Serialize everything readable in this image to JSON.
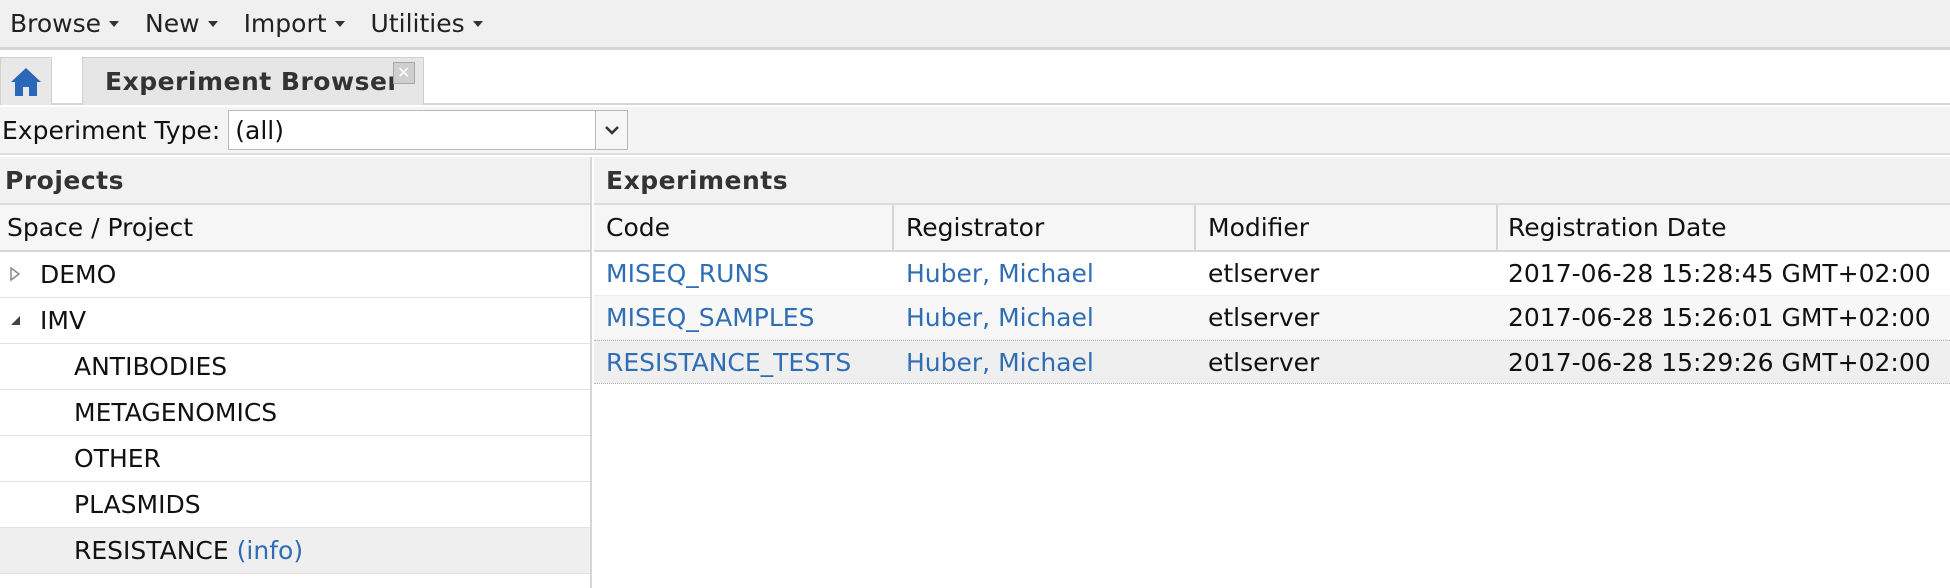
{
  "menu": {
    "items": [
      {
        "label": "Browse"
      },
      {
        "label": "New"
      },
      {
        "label": "Import"
      },
      {
        "label": "Utilities"
      }
    ]
  },
  "tabs": {
    "home_icon": "home-icon",
    "active_tab": "Experiment Browser",
    "close_icon": "close-icon"
  },
  "filter": {
    "label": "Experiment Type:",
    "value": "(all)"
  },
  "projects": {
    "title": "Projects",
    "column_header": "Space / Project",
    "tree": [
      {
        "label": "DEMO",
        "level": 0,
        "state": "collapsed"
      },
      {
        "label": "IMV",
        "level": 0,
        "state": "expanded"
      },
      {
        "label": "ANTIBODIES",
        "level": 1
      },
      {
        "label": "METAGENOMICS",
        "level": 1
      },
      {
        "label": "OTHER",
        "level": 1
      },
      {
        "label": "PLASMIDS",
        "level": 1
      },
      {
        "label": "RESISTANCE",
        "level": 1,
        "info": "(info)",
        "selected": true
      }
    ]
  },
  "experiments": {
    "title": "Experiments",
    "columns": [
      "Code",
      "Registrator",
      "Modifier",
      "Registration Date"
    ],
    "rows": [
      {
        "code": "MISEQ_RUNS",
        "registrator": "Huber, Michael",
        "modifier": "etlserver",
        "date": "2017-06-28 15:28:45 GMT+02:00"
      },
      {
        "code": "MISEQ_SAMPLES",
        "registrator": "Huber, Michael",
        "modifier": "etlserver",
        "date": "2017-06-28 15:26:01 GMT+02:00"
      },
      {
        "code": "RESISTANCE_TESTS",
        "registrator": "Huber, Michael",
        "modifier": "etlserver",
        "date": "2017-06-28 15:29:26 GMT+02:00"
      }
    ]
  },
  "colors": {
    "link": "#2f6db5",
    "home_icon": "#2b67b8"
  }
}
